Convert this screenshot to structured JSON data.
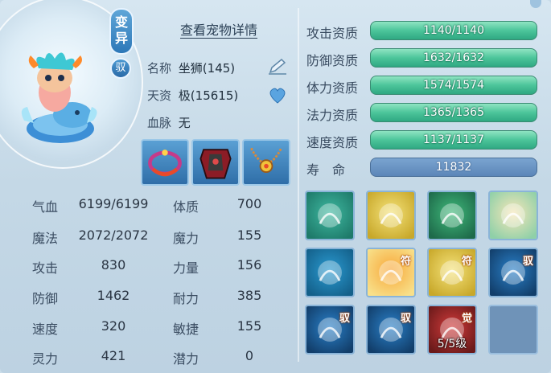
{
  "header": {
    "variant_badge": "变\n异",
    "yu_badge": "驭",
    "detail_link": "查看宠物详情"
  },
  "info": {
    "name_label": "名称",
    "name_value": "坐狮(145)",
    "aptitude_label": "天资",
    "aptitude_value": "极(15615)",
    "bloodline_label": "血脉",
    "bloodline_value": "无"
  },
  "equipment": [
    {
      "name": "bracelet",
      "icon": "ring-icon"
    },
    {
      "name": "armor",
      "icon": "armor-icon"
    },
    {
      "name": "necklace",
      "icon": "necklace-icon"
    }
  ],
  "stats_left": [
    {
      "label": "气血",
      "value": "6199/6199"
    },
    {
      "label": "魔法",
      "value": "2072/2072"
    },
    {
      "label": "攻击",
      "value": "830"
    },
    {
      "label": "防御",
      "value": "1462"
    },
    {
      "label": "速度",
      "value": "320"
    },
    {
      "label": "灵力",
      "value": "421"
    }
  ],
  "stats_right": [
    {
      "label": "体质",
      "value": "700"
    },
    {
      "label": "魔力",
      "value": "155"
    },
    {
      "label": "力量",
      "value": "156"
    },
    {
      "label": "耐力",
      "value": "385"
    },
    {
      "label": "敏捷",
      "value": "155"
    },
    {
      "label": "潜力",
      "value": "0"
    }
  ],
  "qualities": [
    {
      "label": "攻击资质",
      "value": "1140/1140"
    },
    {
      "label": "防御资质",
      "value": "1632/1632"
    },
    {
      "label": "体力资质",
      "value": "1574/1574"
    },
    {
      "label": "法力资质",
      "value": "1365/1365"
    },
    {
      "label": "速度资质",
      "value": "1137/1137"
    }
  ],
  "lifespan": {
    "label": "寿　命",
    "value": "11832"
  },
  "skills": [
    {
      "icon": "wind-swirl-icon",
      "tag": ""
    },
    {
      "icon": "shield-emblem-icon",
      "tag": ""
    },
    {
      "icon": "leaping-deer-icon",
      "tag": ""
    },
    {
      "icon": "hand-fire-icon",
      "tag": ""
    },
    {
      "icon": "cauldron-icon",
      "tag": ""
    },
    {
      "icon": "wings-talisman-icon",
      "tag": "符"
    },
    {
      "icon": "hand-gem-icon",
      "tag": "符"
    },
    {
      "icon": "water-orb-icon",
      "tag": "驭"
    },
    {
      "icon": "guard-shield-icon",
      "tag": "驭"
    },
    {
      "icon": "warrior-icon",
      "tag": "驭"
    },
    {
      "icon": "awakened-icon",
      "tag": "觉",
      "level": "5/5级"
    },
    {
      "icon": "empty-slot",
      "tag": ""
    }
  ]
}
